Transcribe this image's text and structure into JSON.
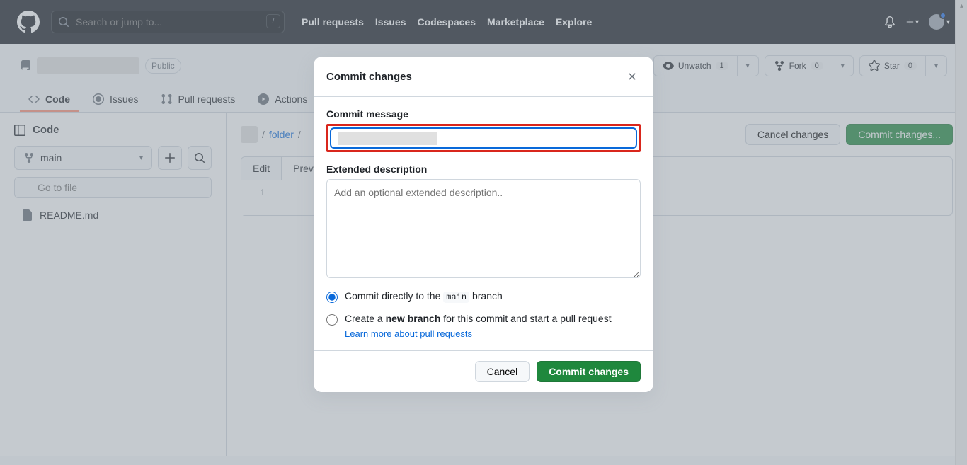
{
  "nav": {
    "search_placeholder": "Search or jump to...",
    "slash": "/",
    "links": [
      "Pull requests",
      "Issues",
      "Codespaces",
      "Marketplace",
      "Explore"
    ]
  },
  "repo": {
    "visibility": "Public",
    "actions": {
      "unwatch": "Unwatch",
      "unwatch_count": "1",
      "fork": "Fork",
      "fork_count": "0",
      "star": "Star",
      "star_count": "0"
    },
    "tabs": {
      "code": "Code",
      "issues": "Issues",
      "pulls": "Pull requests",
      "actions": "Actions"
    }
  },
  "sidebar": {
    "title": "Code",
    "branch": "main",
    "file_filter_placeholder": "Go to file",
    "files": [
      "README.md"
    ]
  },
  "editor": {
    "breadcrumb_folder": "folder",
    "cancel_btn": "Cancel changes",
    "commit_btn": "Commit changes...",
    "tab_edit": "Edit",
    "tab_preview": "Preview",
    "line_number": "1"
  },
  "modal": {
    "title": "Commit changes",
    "commit_msg_label": "Commit message",
    "ext_desc_label": "Extended description",
    "ext_desc_placeholder": "Add an optional extended description..",
    "radio_direct_pre": "Commit directly to the ",
    "radio_direct_branch": "main",
    "radio_direct_post": " branch",
    "radio_new_pre": "Create a ",
    "radio_new_bold": "new branch",
    "radio_new_post": " for this commit and start a pull request",
    "learn_link": "Learn more about pull requests",
    "cancel": "Cancel",
    "commit": "Commit changes"
  }
}
